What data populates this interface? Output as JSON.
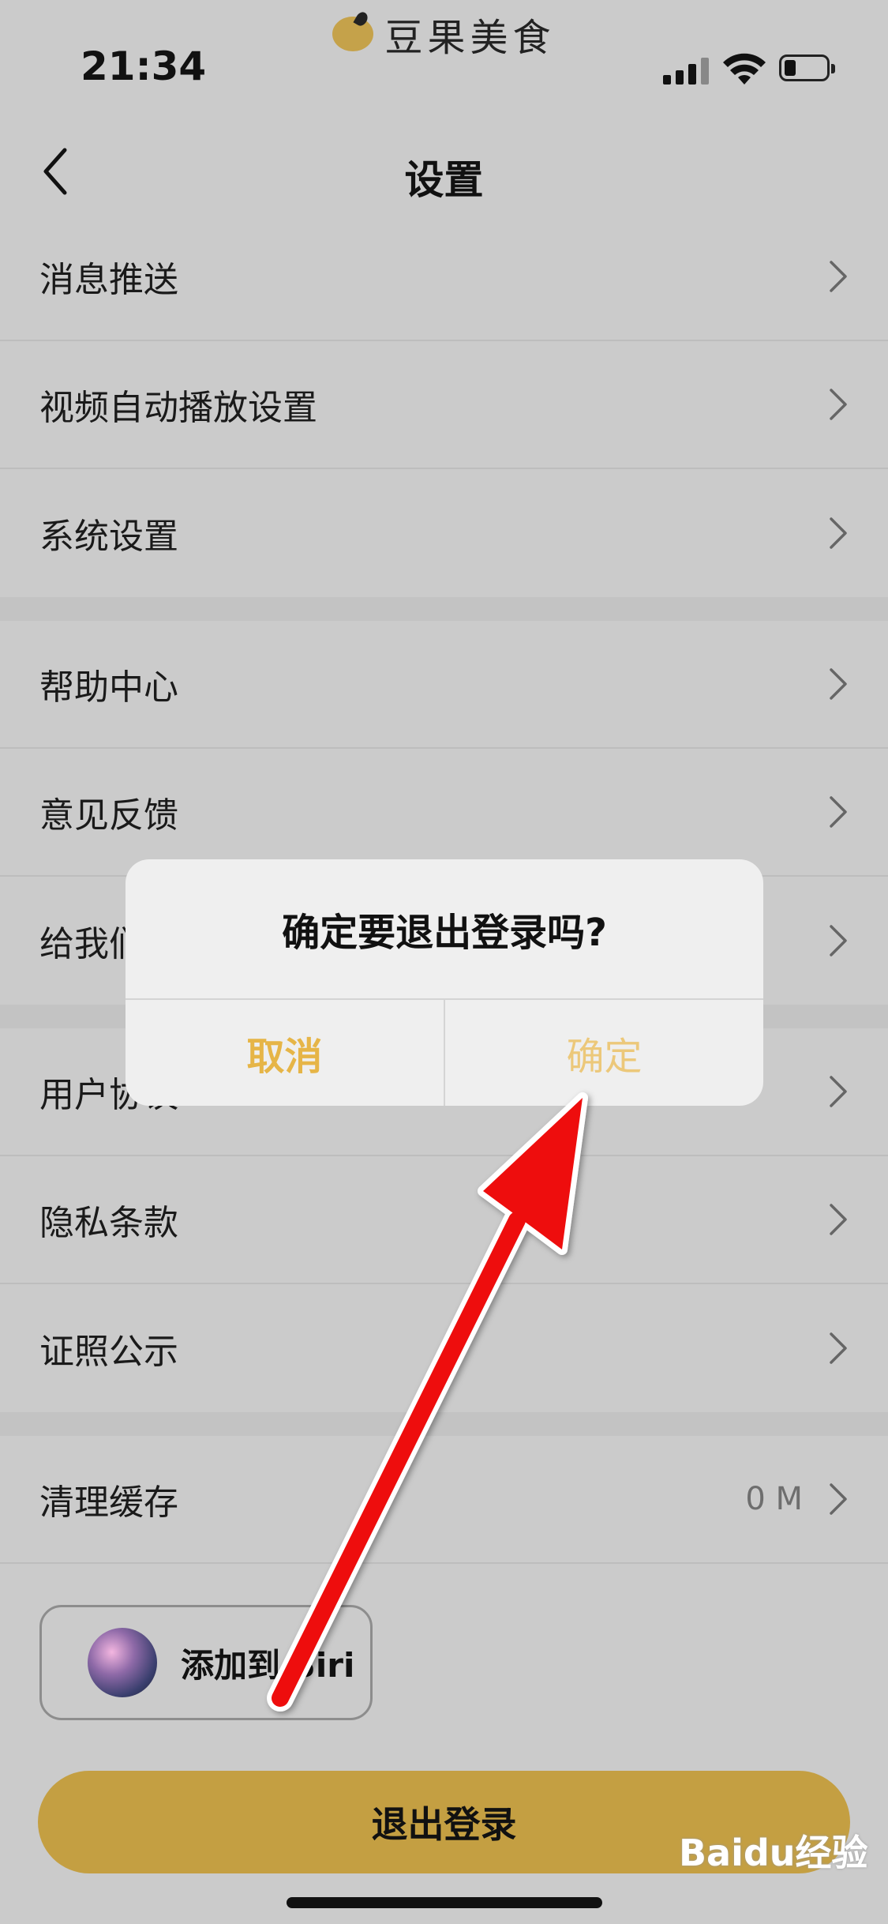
{
  "app_watermark": {
    "text": "豆果美食"
  },
  "status_bar": {
    "time": "21:34"
  },
  "nav": {
    "title": "设置"
  },
  "groups": [
    {
      "items": [
        {
          "label": "消息推送"
        },
        {
          "label": "视频自动播放设置"
        },
        {
          "label": "系统设置"
        }
      ]
    },
    {
      "items": [
        {
          "label": "帮助中心"
        },
        {
          "label": "意见反馈"
        },
        {
          "label": "给我们"
        }
      ]
    },
    {
      "items": [
        {
          "label": "用户协议"
        },
        {
          "label": "隐私条款"
        },
        {
          "label": "证照公示"
        }
      ]
    },
    {
      "items": [
        {
          "label": "清理缓存",
          "value": "0 M"
        }
      ]
    }
  ],
  "siri": {
    "label": "添加到 Siri"
  },
  "logout": {
    "label": "退出登录"
  },
  "dialog": {
    "title": "确定要退出登录吗?",
    "cancel_label": "取消",
    "confirm_label": "确定"
  },
  "watermark": {
    "text": "Baidu经验"
  },
  "colors": {
    "accent_gold": "#c49f42",
    "dialog_action": "#e6b547",
    "arrow_red": "#ee1111"
  }
}
